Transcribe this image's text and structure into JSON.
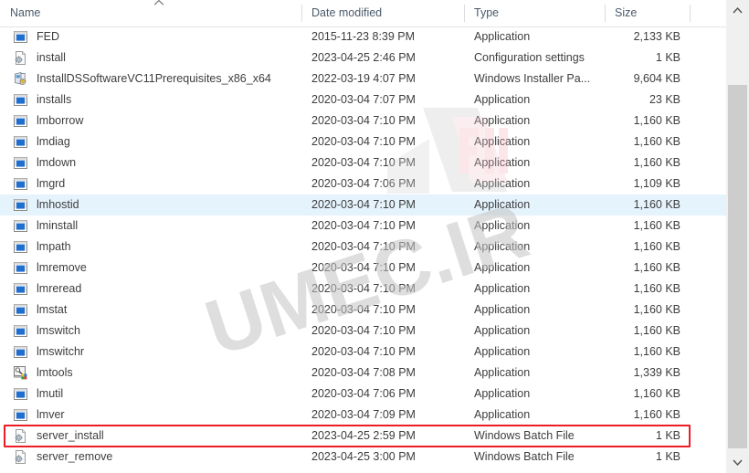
{
  "window": {
    "title": "File Explorer file list"
  },
  "columns": [
    {
      "key": "name",
      "label": "Name",
      "sorted": true,
      "sort_direction": "ascending",
      "sort_icon": "chevron-up-icon"
    },
    {
      "key": "date",
      "label": "Date modified",
      "sorted": false,
      "sort_direction": "",
      "sort_icon": ""
    },
    {
      "key": "type",
      "label": "Type",
      "sorted": false,
      "sort_direction": "",
      "sort_icon": ""
    },
    {
      "key": "size",
      "label": "Size",
      "sorted": false,
      "sort_direction": "",
      "sort_icon": ""
    }
  ],
  "files": [
    {
      "name": "FED",
      "date": "2015-11-23 8:39 PM",
      "type": "Application",
      "size": "2,133 KB",
      "icon": "application-exe-icon",
      "state": "normal"
    },
    {
      "name": "install",
      "date": "2023-04-25 2:46 PM",
      "type": "Configuration settings",
      "size": "1 KB",
      "icon": "config-settings-icon",
      "state": "normal"
    },
    {
      "name": "InstallDSSoftwareVC11Prerequisites_x86_x64",
      "date": "2022-03-19 4:07 PM",
      "type": "Windows Installer Pa...",
      "size": "9,604 KB",
      "icon": "windows-installer-icon",
      "state": "normal"
    },
    {
      "name": "installs",
      "date": "2020-03-04 7:07 PM",
      "type": "Application",
      "size": "23 KB",
      "icon": "application-exe-icon",
      "state": "normal"
    },
    {
      "name": "lmborrow",
      "date": "2020-03-04 7:10 PM",
      "type": "Application",
      "size": "1,160 KB",
      "icon": "application-exe-icon",
      "state": "normal"
    },
    {
      "name": "lmdiag",
      "date": "2020-03-04 7:10 PM",
      "type": "Application",
      "size": "1,160 KB",
      "icon": "application-exe-icon",
      "state": "normal"
    },
    {
      "name": "lmdown",
      "date": "2020-03-04 7:10 PM",
      "type": "Application",
      "size": "1,160 KB",
      "icon": "application-exe-icon",
      "state": "normal"
    },
    {
      "name": "lmgrd",
      "date": "2020-03-04 7:06 PM",
      "type": "Application",
      "size": "1,109 KB",
      "icon": "application-exe-icon",
      "state": "normal"
    },
    {
      "name": "lmhostid",
      "date": "2020-03-04 7:10 PM",
      "type": "Application",
      "size": "1,160 KB",
      "icon": "application-exe-icon",
      "state": "hover"
    },
    {
      "name": "lminstall",
      "date": "2020-03-04 7:10 PM",
      "type": "Application",
      "size": "1,160 KB",
      "icon": "application-exe-icon",
      "state": "normal"
    },
    {
      "name": "lmpath",
      "date": "2020-03-04 7:10 PM",
      "type": "Application",
      "size": "1,160 KB",
      "icon": "application-exe-icon",
      "state": "normal"
    },
    {
      "name": "lmremove",
      "date": "2020-03-04 7:10 PM",
      "type": "Application",
      "size": "1,160 KB",
      "icon": "application-exe-icon",
      "state": "normal"
    },
    {
      "name": "lmreread",
      "date": "2020-03-04 7:10 PM",
      "type": "Application",
      "size": "1,160 KB",
      "icon": "application-exe-icon",
      "state": "normal"
    },
    {
      "name": "lmstat",
      "date": "2020-03-04 7:10 PM",
      "type": "Application",
      "size": "1,160 KB",
      "icon": "application-exe-icon",
      "state": "normal"
    },
    {
      "name": "lmswitch",
      "date": "2020-03-04 7:10 PM",
      "type": "Application",
      "size": "1,160 KB",
      "icon": "application-exe-icon",
      "state": "normal"
    },
    {
      "name": "lmswitchr",
      "date": "2020-03-04 7:10 PM",
      "type": "Application",
      "size": "1,160 KB",
      "icon": "application-exe-icon",
      "state": "normal"
    },
    {
      "name": "lmtools",
      "date": "2020-03-04 7:08 PM",
      "type": "Application",
      "size": "1,339 KB",
      "icon": "lmtools-app-icon",
      "state": "normal"
    },
    {
      "name": "lmutil",
      "date": "2020-03-04 7:06 PM",
      "type": "Application",
      "size": "1,160 KB",
      "icon": "application-exe-icon",
      "state": "normal"
    },
    {
      "name": "lmver",
      "date": "2020-03-04 7:09 PM",
      "type": "Application",
      "size": "1,160 KB",
      "icon": "application-exe-icon",
      "state": "normal"
    },
    {
      "name": "server_install",
      "date": "2023-04-25 2:59 PM",
      "type": "Windows Batch File",
      "size": "1 KB",
      "icon": "batch-file-icon",
      "state": "highlighted"
    },
    {
      "name": "server_remove",
      "date": "2023-04-25 3:00 PM",
      "type": "Windows Batch File",
      "size": "1 KB",
      "icon": "batch-file-icon",
      "state": "normal"
    }
  ],
  "highlight": {
    "target_file": "server_install",
    "color": "#ee1c25"
  },
  "watermark": {
    "text": "UMEC.IR",
    "logo": "umec-logo-mark"
  },
  "scrollbar": {
    "up_arrow": "chevron-up-icon",
    "down_arrow": "chevron-down-icon",
    "thumb": "scrollbar-thumb"
  },
  "colors": {
    "selection": "#e5f3fd",
    "header_text": "#4a5a6a",
    "row_text": "#3d3d3d",
    "accent": "#ee1c25"
  }
}
